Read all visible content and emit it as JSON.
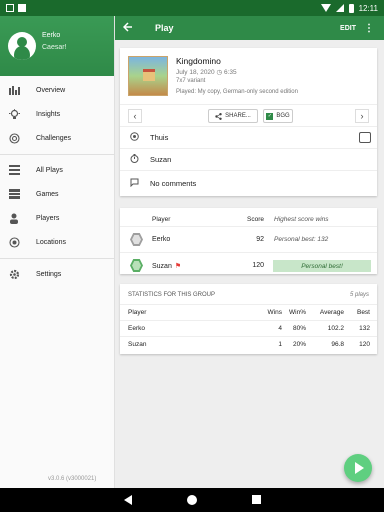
{
  "status_bar": {
    "time": "12:11"
  },
  "drawer": {
    "user_name": "Eerko",
    "user_sub": "Caesar!",
    "items": [
      {
        "label": "Overview",
        "icon": "bar-chart-icon"
      },
      {
        "label": "Insights",
        "icon": "lightbulb-icon"
      },
      {
        "label": "Challenges",
        "icon": "target-icon"
      },
      {
        "label": "All Plays",
        "icon": "list-icon"
      },
      {
        "label": "Games",
        "icon": "grid-icon"
      },
      {
        "label": "Players",
        "icon": "person-icon"
      },
      {
        "label": "Locations",
        "icon": "location-icon"
      },
      {
        "label": "Settings",
        "icon": "gear-icon"
      }
    ],
    "version": "v3.0.6 (v3000021)"
  },
  "appbar": {
    "title": "Play",
    "edit_label": "EDIT",
    "more_icon": "more-vert-icon"
  },
  "game": {
    "title": "Kingdomino",
    "date": "July 18, 2020 ◷ 6:35",
    "variant": "7x7 variant",
    "played": "Played: My copy, German-only second edition",
    "share_label": "SHARE...",
    "bgg_label": "BGG"
  },
  "info": {
    "location": "Thuis",
    "player": "Suzan",
    "comments": "No comments"
  },
  "scores": {
    "header_player": "Player",
    "header_score": "Score",
    "header_note": "Highest score wins",
    "rows": [
      {
        "name": "Eerko",
        "score": "92",
        "note": "Personal best: 132",
        "winner": false
      },
      {
        "name": "Suzan",
        "score": "120",
        "note": "Personal best!",
        "winner": true
      }
    ]
  },
  "stats": {
    "title": "STATISTICS FOR THIS GROUP",
    "count": "5 plays",
    "headers": {
      "player": "Player",
      "wins": "Wins",
      "winp": "Win%",
      "avg": "Average",
      "best": "Best"
    },
    "rows": [
      {
        "player": "Eerko",
        "wins": "4",
        "winp": "80%",
        "avg": "102.2",
        "best": "132"
      },
      {
        "player": "Suzan",
        "wins": "1",
        "winp": "20%",
        "avg": "96.8",
        "best": "120"
      }
    ]
  },
  "colors": {
    "primary": "#2f8a48",
    "status_bar": "#1a6a2c",
    "fab": "#5fcf80",
    "best_highlight": "#c8e6c9"
  }
}
